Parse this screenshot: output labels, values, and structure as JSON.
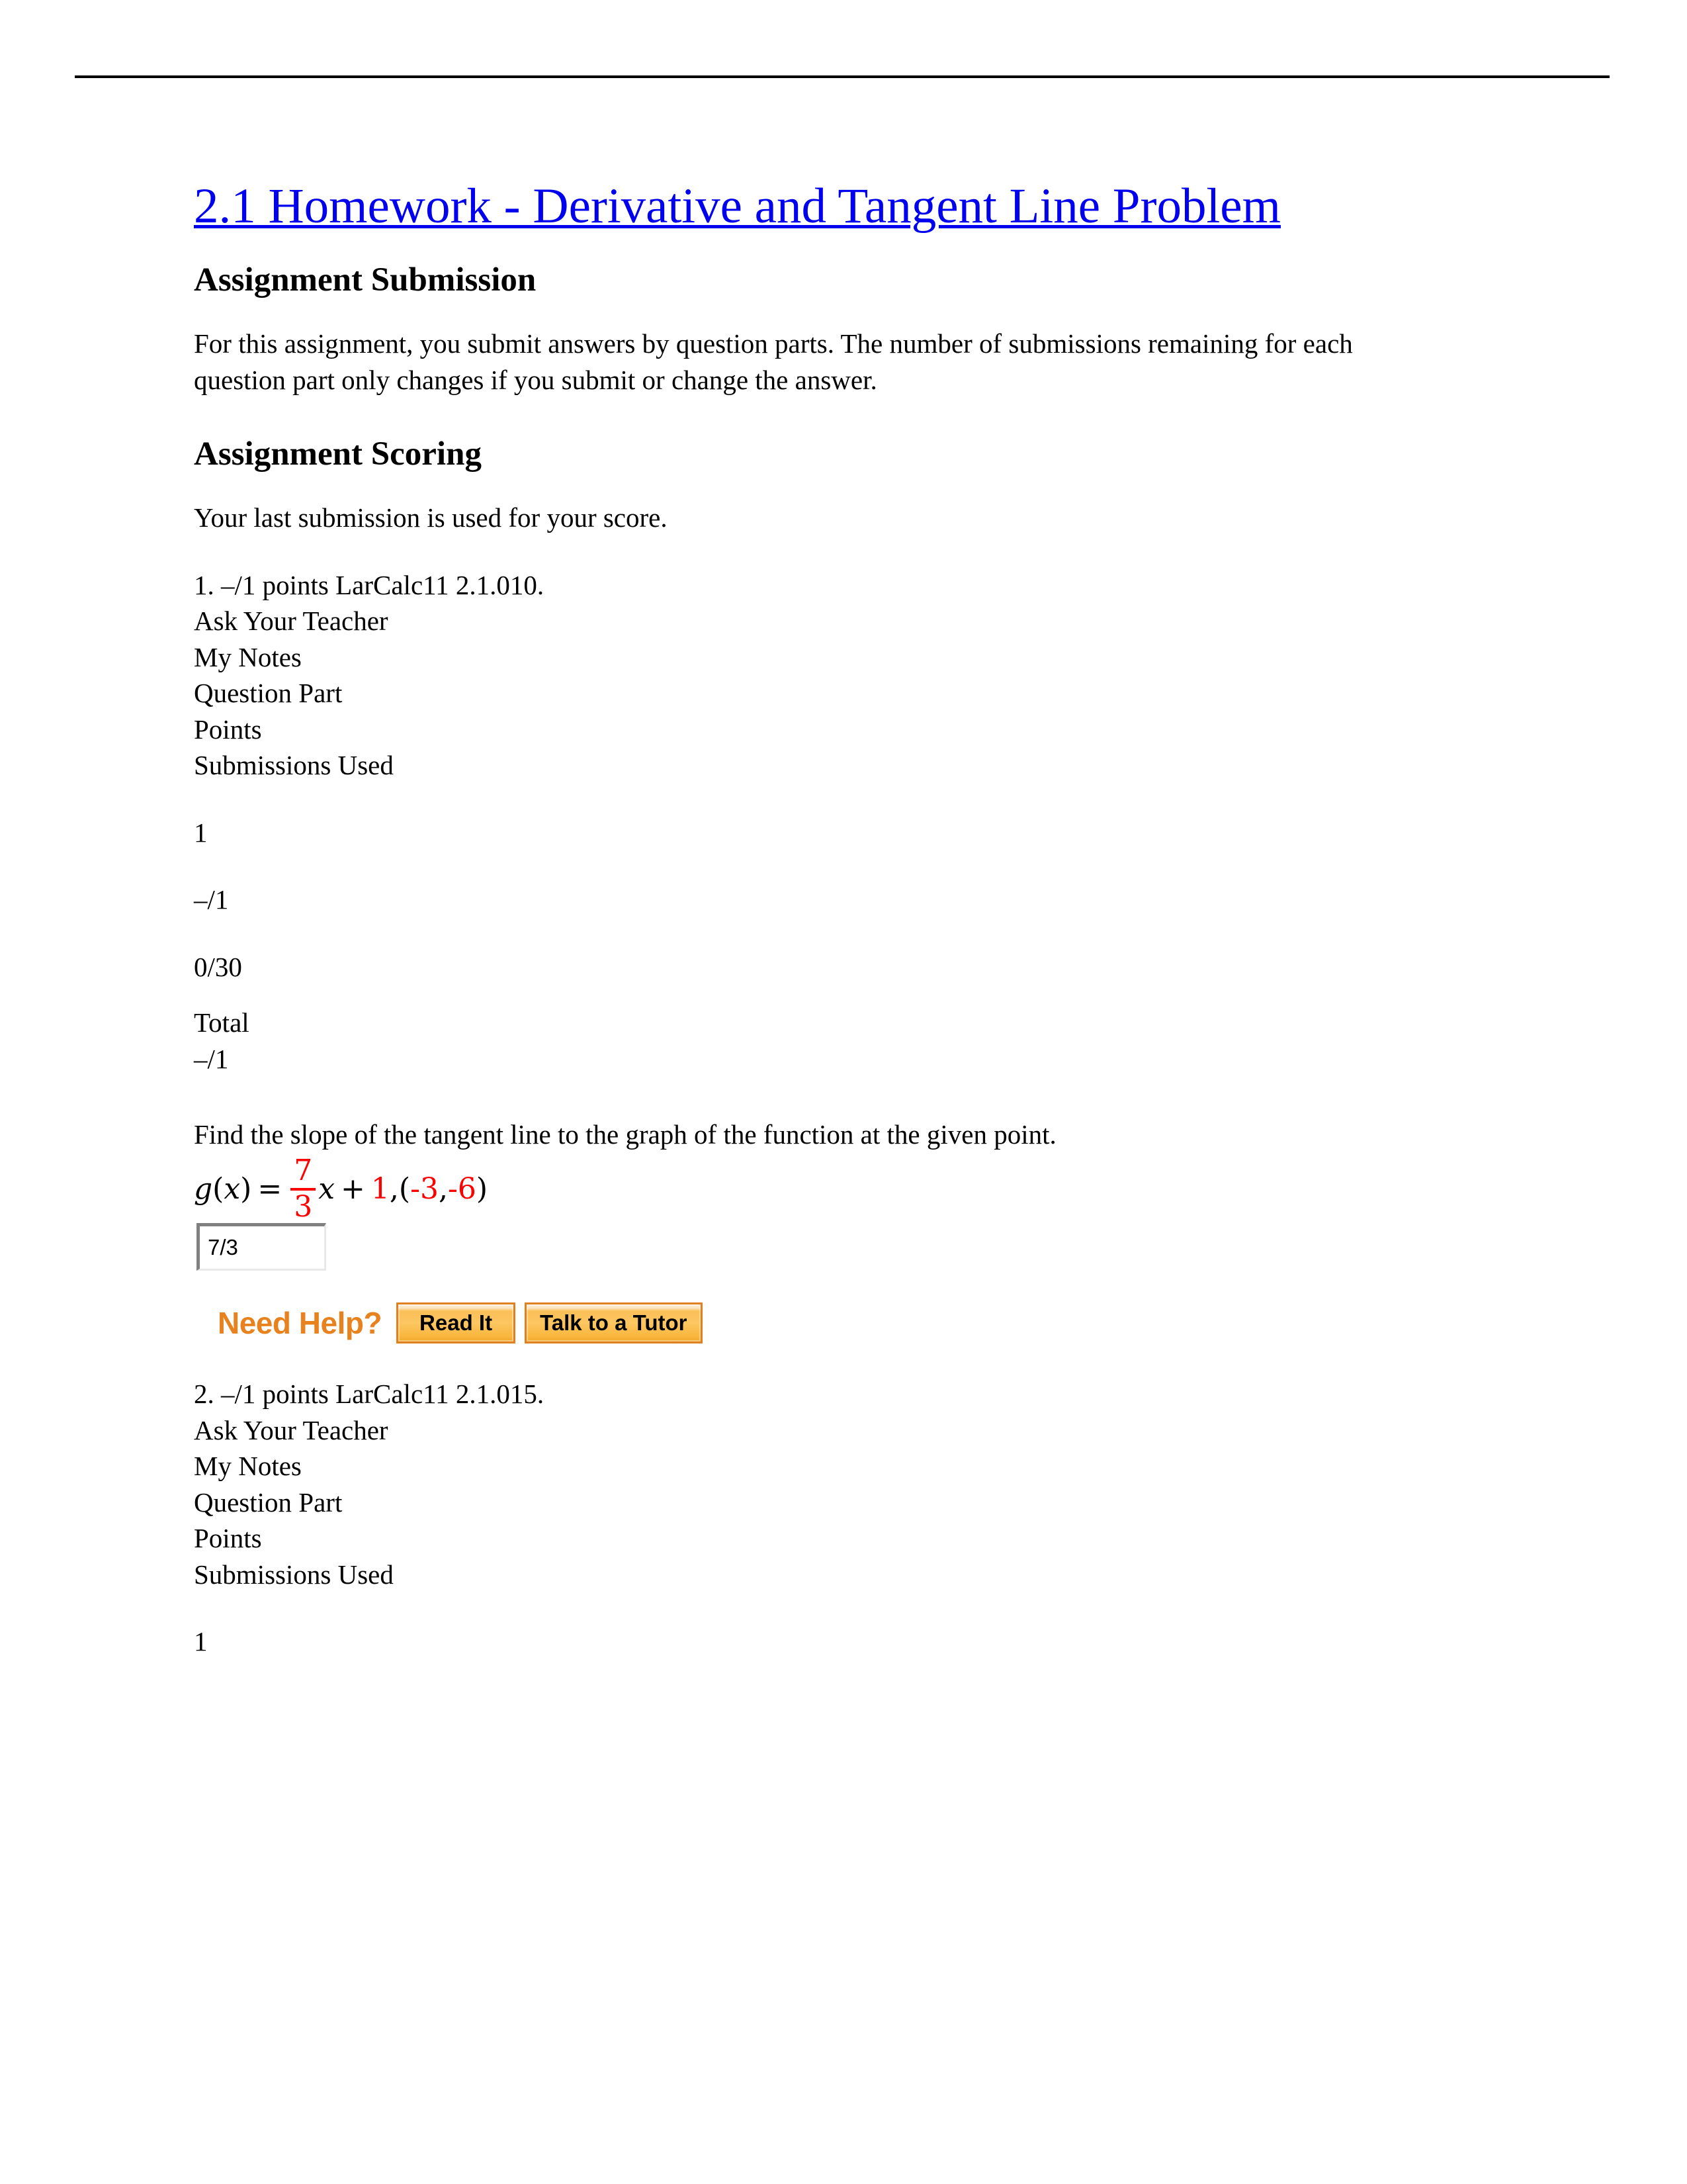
{
  "document": {
    "title": "2.1 Homework - Derivative and Tangent Line Problem",
    "rule": "horizontal-rule"
  },
  "sections": {
    "submission": {
      "heading": "Assignment Submission",
      "body": "For this assignment, you submit answers by question parts. The number of submissions remaining for each question part only changes if you submit or change the answer."
    },
    "scoring": {
      "heading": "Assignment Scoring",
      "body": "Your last submission is used for your score."
    }
  },
  "questions": [
    {
      "header": "1. –/1 points LarCalc11 2.1.010.",
      "ask_teacher": "Ask Your Teacher",
      "my_notes": "My Notes",
      "col_question_part": "Question Part",
      "col_points": "Points",
      "col_submissions_used": "Submissions Used",
      "part_number": "1",
      "part_points": "–/1",
      "part_submissions": "0/30",
      "total_label": "Total",
      "total_points": "–/1",
      "prompt": "Find the slope of the tangent line to the graph of the function at the given point.",
      "math": {
        "func_name": "g",
        "open_paren": "(",
        "var": "x",
        "close_paren": ")",
        "equals": "=",
        "frac_numerator": "7",
        "frac_denominator": "3",
        "times_var": "x",
        "plus": "+",
        "constant": "1",
        "comma": ", ",
        "point_open": "(",
        "point_x": "-3",
        "point_sep": ", ",
        "point_y": "-6",
        "point_close": ")",
        "red_color": "#ff0000"
      },
      "answer": {
        "value": "7/3",
        "placeholder": ""
      },
      "help": {
        "label": "Need Help?",
        "read_it": "Read It",
        "talk_to_tutor": "Talk to a Tutor"
      }
    },
    {
      "header": "2. –/1 points LarCalc11 2.1.015.",
      "ask_teacher": "Ask Your Teacher",
      "my_notes": "My Notes",
      "col_question_part": "Question Part",
      "col_points": "Points",
      "col_submissions_used": "Submissions Used",
      "part_number": "1"
    }
  ],
  "colors": {
    "link": "#0000ee",
    "accent_orange": "#e8821e",
    "math_red": "#ff0000",
    "text": "#000000"
  }
}
